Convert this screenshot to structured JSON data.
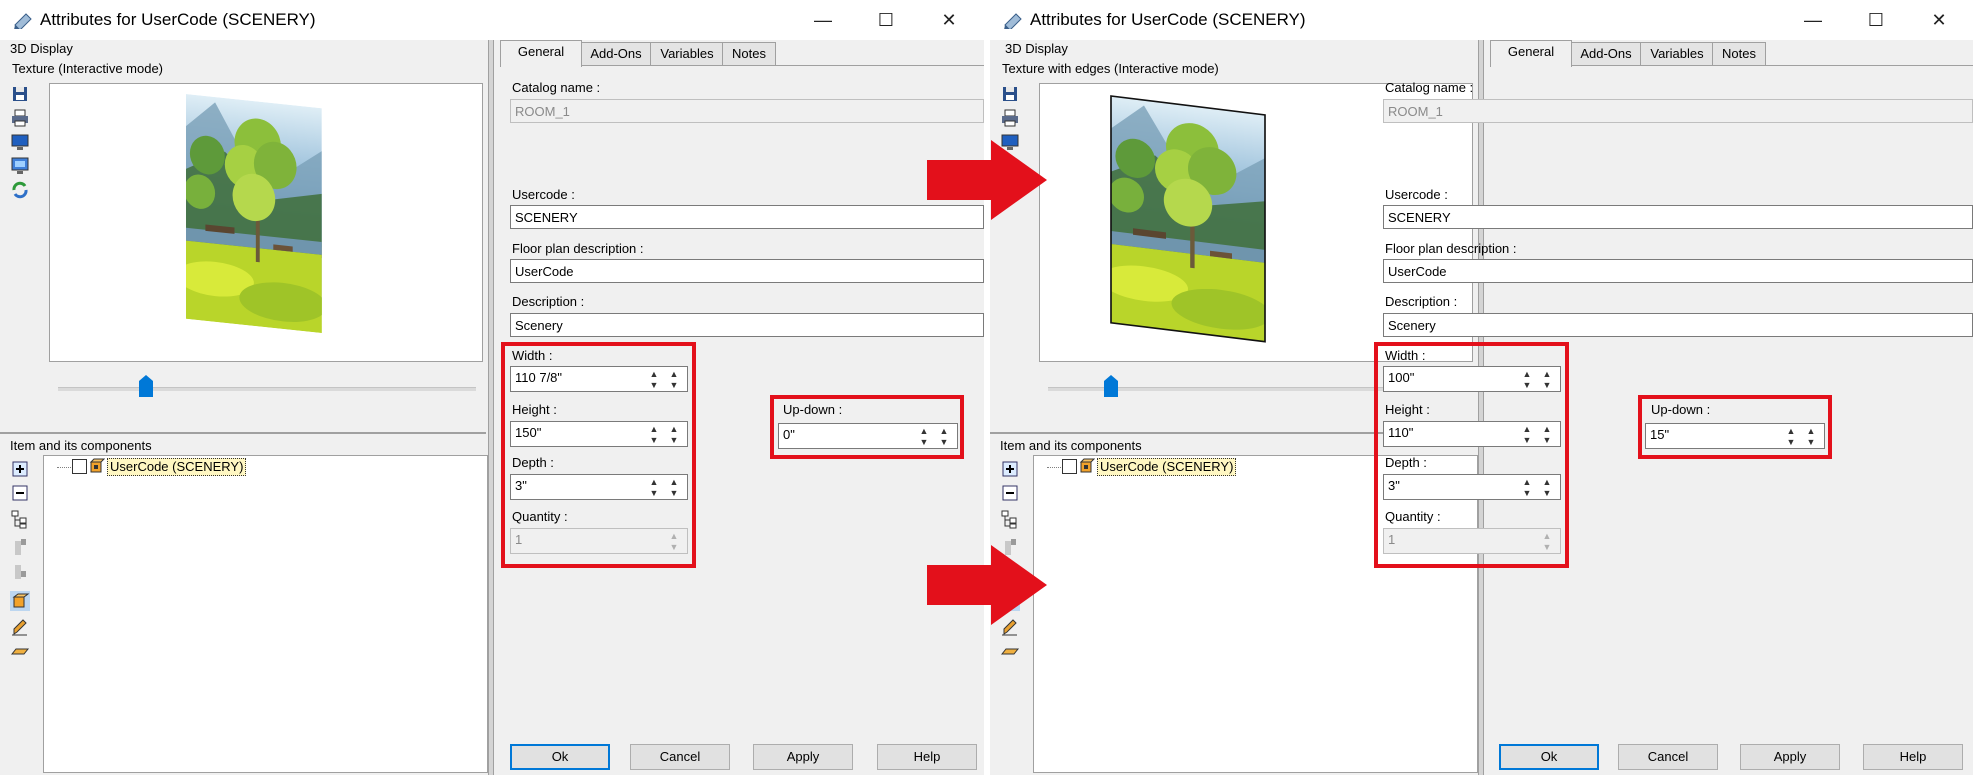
{
  "left": {
    "title": "Attributes for UserCode (SCENERY)",
    "window_controls": {
      "minimize": "—",
      "maximize": "☐",
      "close": "✕"
    },
    "display_section": "3D Display",
    "display_mode": "Texture (Interactive mode)",
    "components_section": "Item and its components",
    "tree_item": "UserCode (SCENERY)",
    "tabs": [
      "General",
      "Add-Ons",
      "Variables",
      "Notes"
    ],
    "catalog_label": "Catalog name :",
    "catalog_value": "ROOM_1",
    "usercode_label": "Usercode :",
    "usercode_value": "SCENERY",
    "floorplan_label": "Floor plan description :",
    "floorplan_value": "UserCode",
    "description_label": "Description :",
    "description_value": "Scenery",
    "width_label": "Width :",
    "width_value": "110 7/8\"",
    "height_label": "Height :",
    "height_value": "150\"",
    "depth_label": "Depth :",
    "depth_value": "3\"",
    "quantity_label": "Quantity :",
    "quantity_value": "1",
    "updown_label": "Up-down :",
    "updown_value": "0\"",
    "buttons": {
      "ok": "Ok",
      "cancel": "Cancel",
      "apply": "Apply",
      "help": "Help"
    }
  },
  "right": {
    "title": "Attributes for UserCode (SCENERY)",
    "window_controls": {
      "minimize": "—",
      "maximize": "☐",
      "close": "✕"
    },
    "display_section": "3D Display",
    "display_mode": "Texture with edges (Interactive mode)",
    "components_section": "Item and its components",
    "tree_item": "UserCode (SCENERY)",
    "tabs": [
      "General",
      "Add-Ons",
      "Variables",
      "Notes"
    ],
    "catalog_label": "Catalog name :",
    "catalog_value": "ROOM_1",
    "usercode_label": "Usercode :",
    "usercode_value": "SCENERY",
    "floorplan_label": "Floor plan description :",
    "floorplan_value": "UserCode",
    "description_label": "Description :",
    "description_value": "Scenery",
    "width_label": "Width :",
    "width_value": "100\"",
    "height_label": "Height :",
    "height_value": "110\"",
    "depth_label": "Depth :",
    "depth_value": "3\"",
    "quantity_label": "Quantity :",
    "quantity_value": "1",
    "updown_label": "Up-down :",
    "updown_value": "15\"",
    "buttons": {
      "ok": "Ok",
      "cancel": "Cancel",
      "apply": "Apply",
      "help": "Help"
    }
  },
  "colors": {
    "highlight": "#e3101b",
    "arrow": "#e3101b",
    "tree_label_bg": "#fff7c2",
    "slider_thumb": "#0078d7"
  },
  "icons": {
    "title": "pencil-icon",
    "toolbar": [
      "save-icon",
      "print-icon",
      "monitor-icon",
      "display-settings-icon",
      "refresh-icon"
    ],
    "tree_toolbar": [
      "expand-icon",
      "collapse-icon",
      "hierarchy-icon",
      "move-up-icon",
      "move-down-icon",
      "box-3d-icon",
      "edit-icon",
      "flat-icon"
    ]
  }
}
